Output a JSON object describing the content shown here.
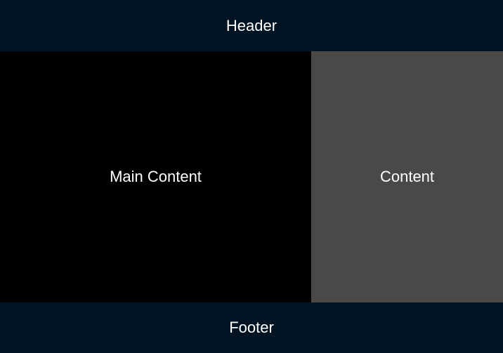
{
  "colors": {
    "header_bg": "#001423",
    "footer_bg": "#001423",
    "main_bg": "#000000",
    "side_bg": "#4a4948",
    "text": "#ffffff"
  },
  "header": {
    "title": "Header"
  },
  "main": {
    "label": "Main Content"
  },
  "side": {
    "label": "Content"
  },
  "footer": {
    "label": "Footer"
  }
}
